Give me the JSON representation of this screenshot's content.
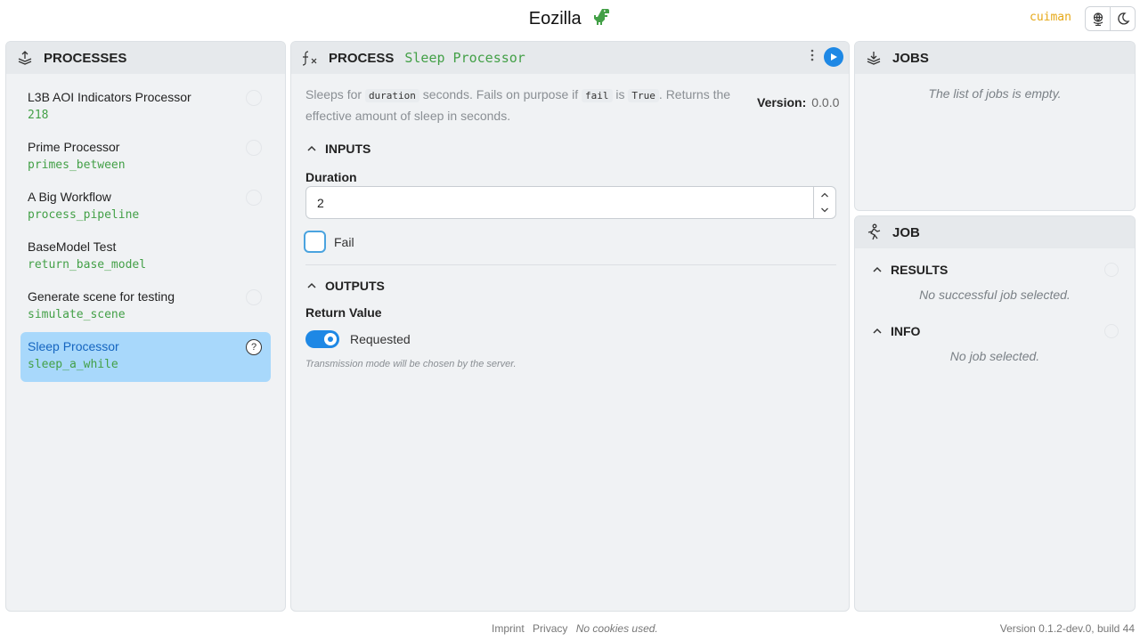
{
  "app": {
    "title": "Eozilla",
    "user": "cuiman"
  },
  "processes_panel": {
    "title": "PROCESSES",
    "items": [
      {
        "name": "L3B AOI Indicators Processor",
        "id": "218"
      },
      {
        "name": "Prime Processor",
        "id": "primes_between"
      },
      {
        "name": "A Big Workflow",
        "id": "process_pipeline"
      },
      {
        "name": "BaseModel Test",
        "id": "return_base_model"
      },
      {
        "name": "Generate scene for testing",
        "id": "simulate_scene"
      },
      {
        "name": "Sleep Processor",
        "id": "sleep_a_while",
        "selected": true
      }
    ]
  },
  "process_panel": {
    "title": "PROCESS",
    "process_name": "Sleep Processor",
    "description": {
      "p1": "Sleeps for ",
      "code1": "duration",
      "p2": " seconds. Fails on purpose if ",
      "code2": "fail",
      "p3": " is ",
      "code3": "True",
      "p4": ". Returns the effective amount of sleep in seconds."
    },
    "version_label": "Version:",
    "version_value": "0.0.0",
    "inputs_title": "INPUTS",
    "duration_label": "Duration",
    "duration_value": "2",
    "fail_label": "Fail",
    "outputs_title": "OUTPUTS",
    "return_value_label": "Return Value",
    "requested_label": "Requested",
    "requested_on": true,
    "transmission_hint": "Transmission mode will be chosen by the server."
  },
  "jobs_panel": {
    "title": "JOBS",
    "empty_text": "The list of jobs is empty."
  },
  "job_panel": {
    "title": "JOB",
    "results_title": "RESULTS",
    "results_empty": "No successful job selected.",
    "info_title": "INFO",
    "info_empty": "No job selected."
  },
  "footer": {
    "imprint": "Imprint",
    "privacy": "Privacy",
    "cookies_note": "No cookies used.",
    "version": "Version 0.1.2-dev.0, build 44"
  },
  "colors": {
    "accent": "#1e88e5",
    "selected_bg": "#a8d8fb",
    "id_green": "#43a047",
    "user": "#e6a817"
  }
}
